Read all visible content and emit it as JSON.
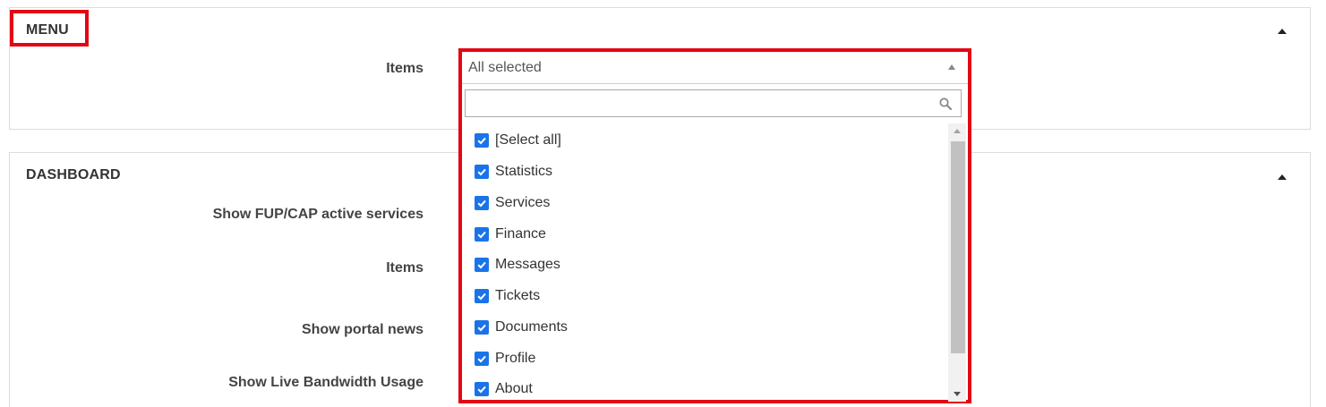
{
  "menu_panel": {
    "title": "MENU",
    "items_label": "Items"
  },
  "dashboard_panel": {
    "title": "DASHBOARD",
    "fields": [
      {
        "label": "Show FUP/CAP active services"
      },
      {
        "label": "Items"
      },
      {
        "label": "Show portal news"
      },
      {
        "label": "Show Live Bandwidth Usage"
      }
    ]
  },
  "multiselect": {
    "selected_text": "All selected",
    "search_value": "",
    "search_placeholder": "",
    "options": [
      {
        "label": " [Select all]",
        "checked": true
      },
      {
        "label": "Statistics",
        "checked": true
      },
      {
        "label": "Services",
        "checked": true
      },
      {
        "label": "Finance",
        "checked": true
      },
      {
        "label": "Messages",
        "checked": true
      },
      {
        "label": "Tickets",
        "checked": true
      },
      {
        "label": "Documents",
        "checked": true
      },
      {
        "label": "Profile",
        "checked": true
      },
      {
        "label": "About",
        "checked": true
      }
    ]
  },
  "colors": {
    "highlight": "#e30613",
    "checkbox": "#1a73e8"
  },
  "icons": {
    "collapse": "triangle-up-icon",
    "search": "magnifier-icon",
    "check": "checkmark-icon"
  }
}
